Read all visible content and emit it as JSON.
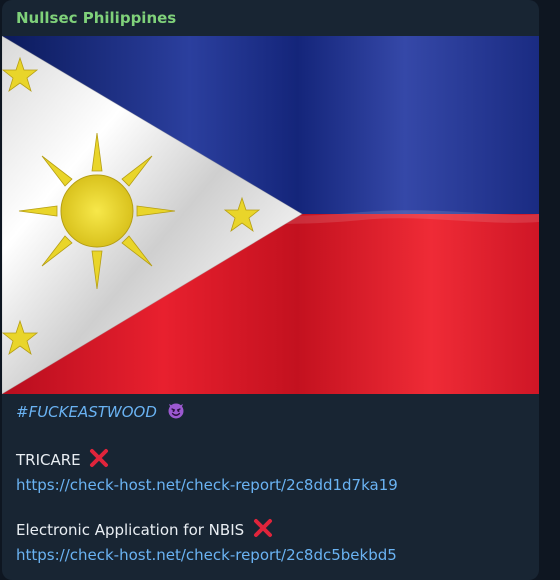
{
  "message": {
    "sender_name": "Nullsec Philippines",
    "image_icon": "philippine-flag",
    "hashtag": "#FUCKEASTWOOD",
    "hashtag_emoji": "smiling-devil-icon",
    "entries": [
      {
        "label": "TRICARE",
        "status_icon": "cross-mark-icon",
        "link": "https://check-host.net/check-report/2c8dd1d7ka19"
      },
      {
        "label": "Electronic Application for NBIS",
        "status_icon": "cross-mark-icon",
        "link": "https://check-host.net/check-report/2c8dc5bekbd5"
      }
    ]
  },
  "colors": {
    "background": "#0e1621",
    "bubble": "#182533",
    "sender": "#7fd17a",
    "link": "#6ab3f3",
    "text": "#e9eef3",
    "cross": "#e0243b"
  }
}
